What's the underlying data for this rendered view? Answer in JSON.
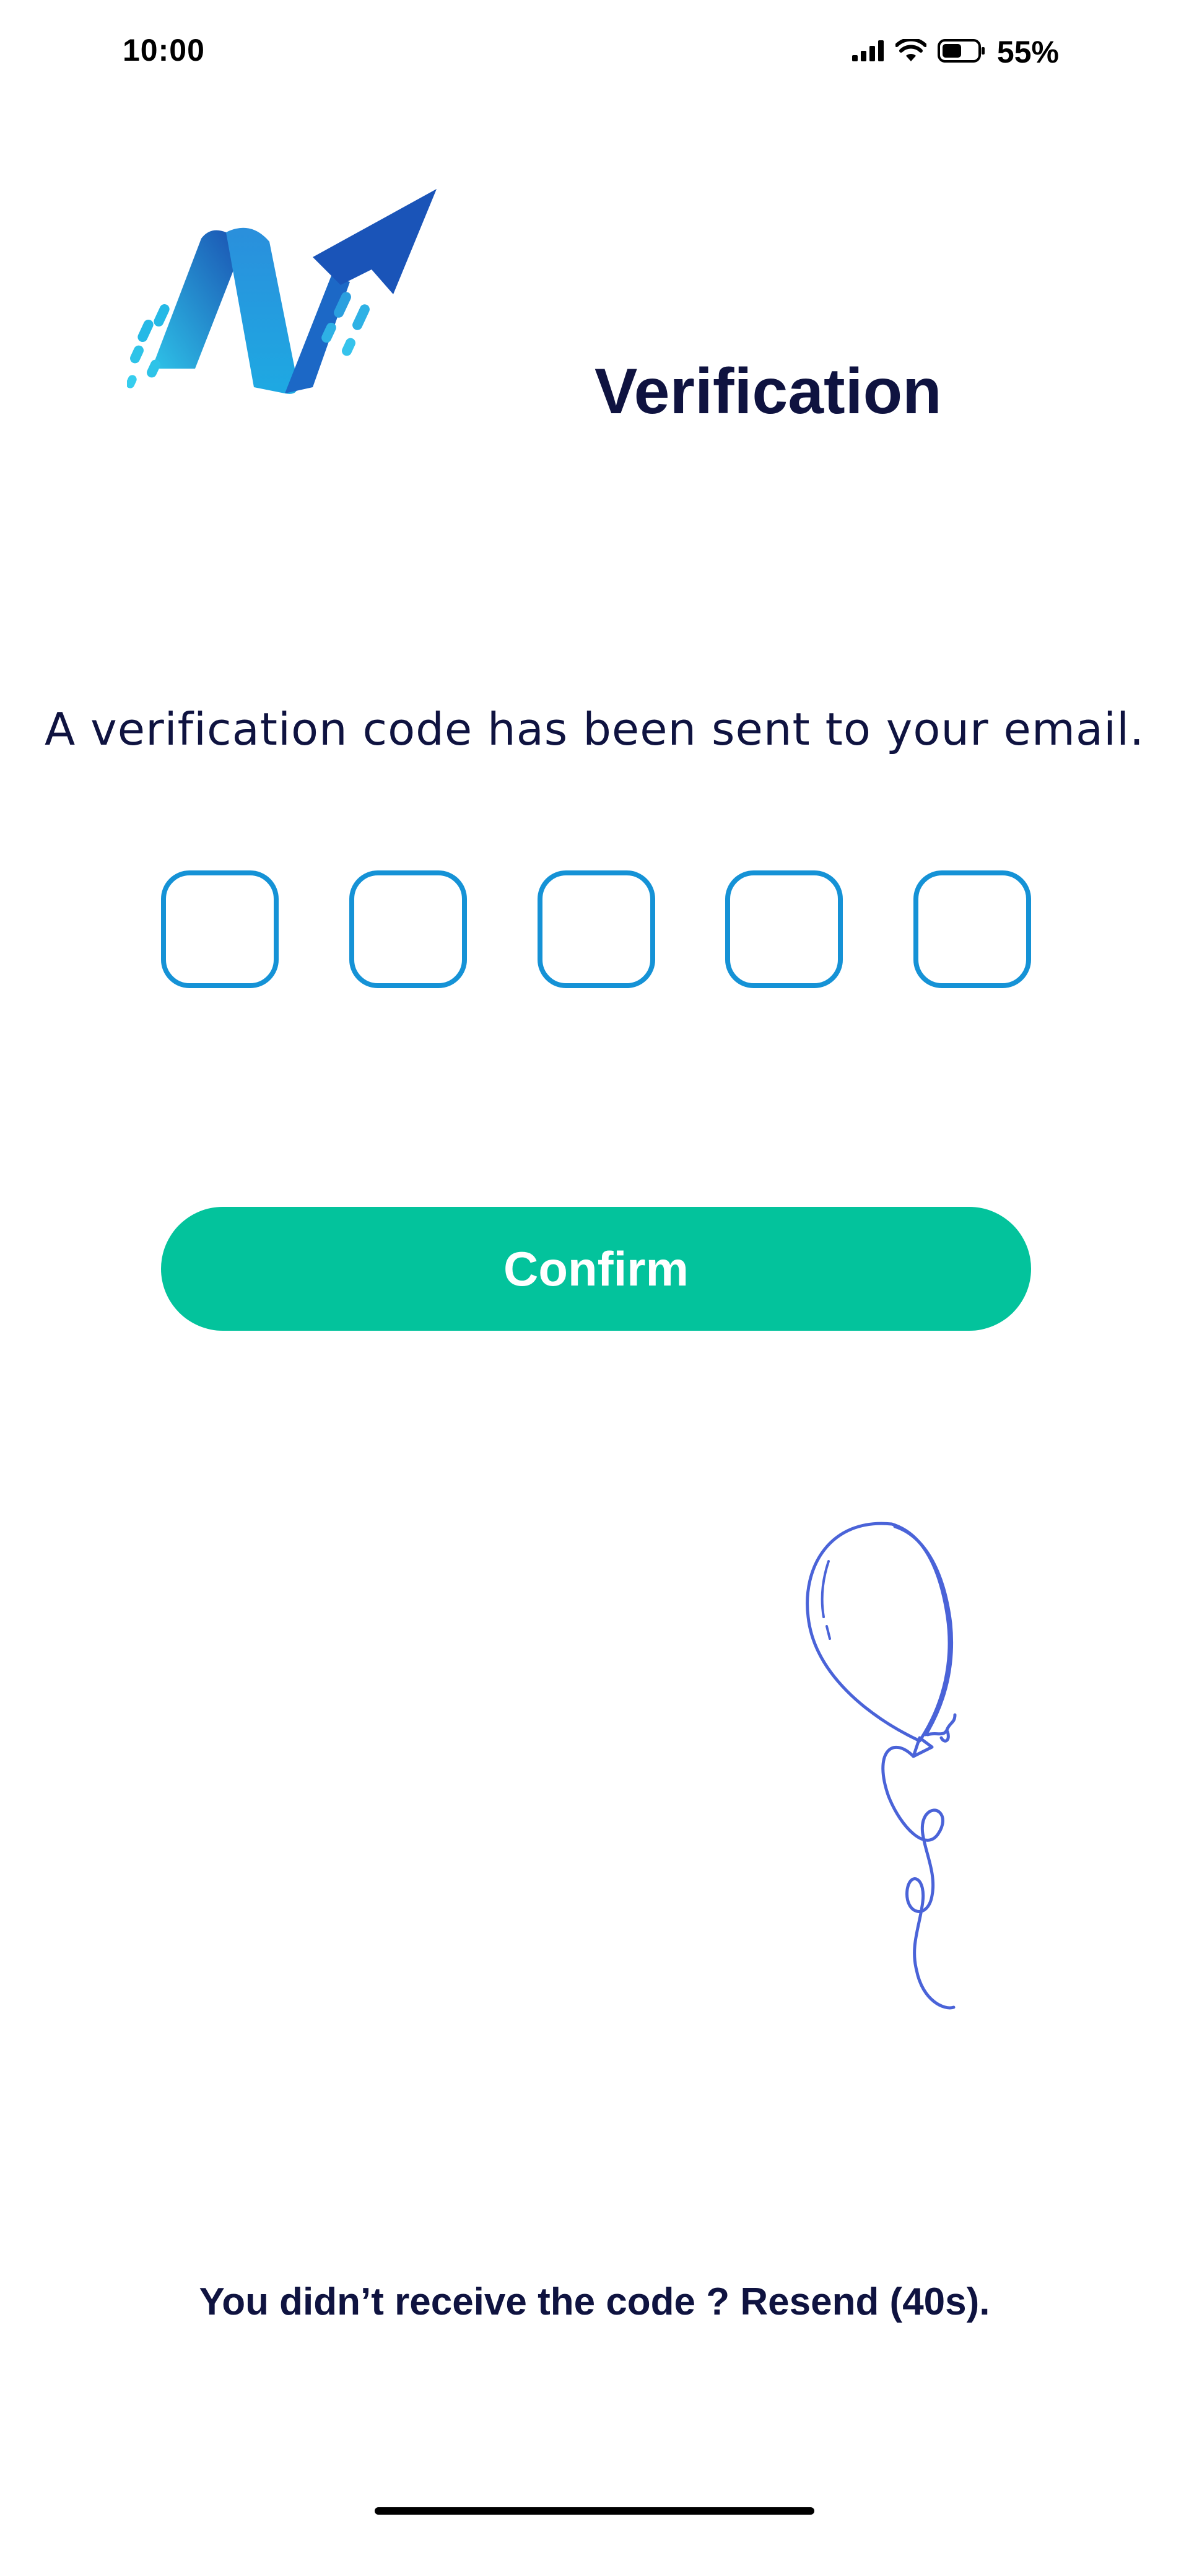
{
  "status_bar": {
    "time": "10:00",
    "battery_percent": "55%",
    "battery_level": 0.55,
    "icons": [
      "signal-icon",
      "wifi-icon",
      "battery-icon"
    ]
  },
  "header": {
    "logo_icon": "app-logo-icon",
    "title": "Verification"
  },
  "verification": {
    "message": "A verification code has been sent to your email.",
    "code_length": 5,
    "code_values": [
      "",
      "",
      "",
      "",
      ""
    ]
  },
  "actions": {
    "confirm_label": "Confirm"
  },
  "decoration": {
    "balloon_icon": "balloon-icon"
  },
  "footer": {
    "resend_prefix": "You didn’t receive the code ? ",
    "resend_link": "Resend (40s)",
    "resend_suffix": "."
  },
  "colors": {
    "accent": "#1592d6",
    "button": "#03c39c",
    "text": "#0f1340",
    "balloon": "#4a63d8"
  }
}
